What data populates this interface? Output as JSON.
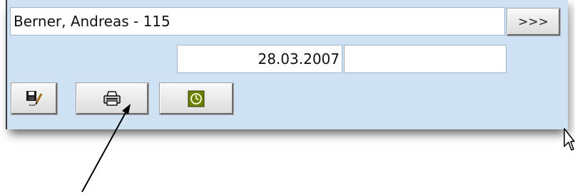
{
  "record": {
    "name_value": "Berner, Andreas - 115",
    "more_label": ">>>"
  },
  "date_row": {
    "date_value": "28.03.2007",
    "extra_value": ""
  },
  "toolbar": {
    "buttons": [
      {
        "id": "save",
        "icon": "save-edit-icon"
      },
      {
        "id": "print",
        "icon": "printer-icon"
      },
      {
        "id": "clock",
        "icon": "clock-icon"
      }
    ]
  },
  "annotation": {
    "type": "pointer-arrow",
    "target": "print-button"
  },
  "colors": {
    "panel_bg": "#cfe2f3",
    "clock_icon_bg": "#6b7f00"
  }
}
